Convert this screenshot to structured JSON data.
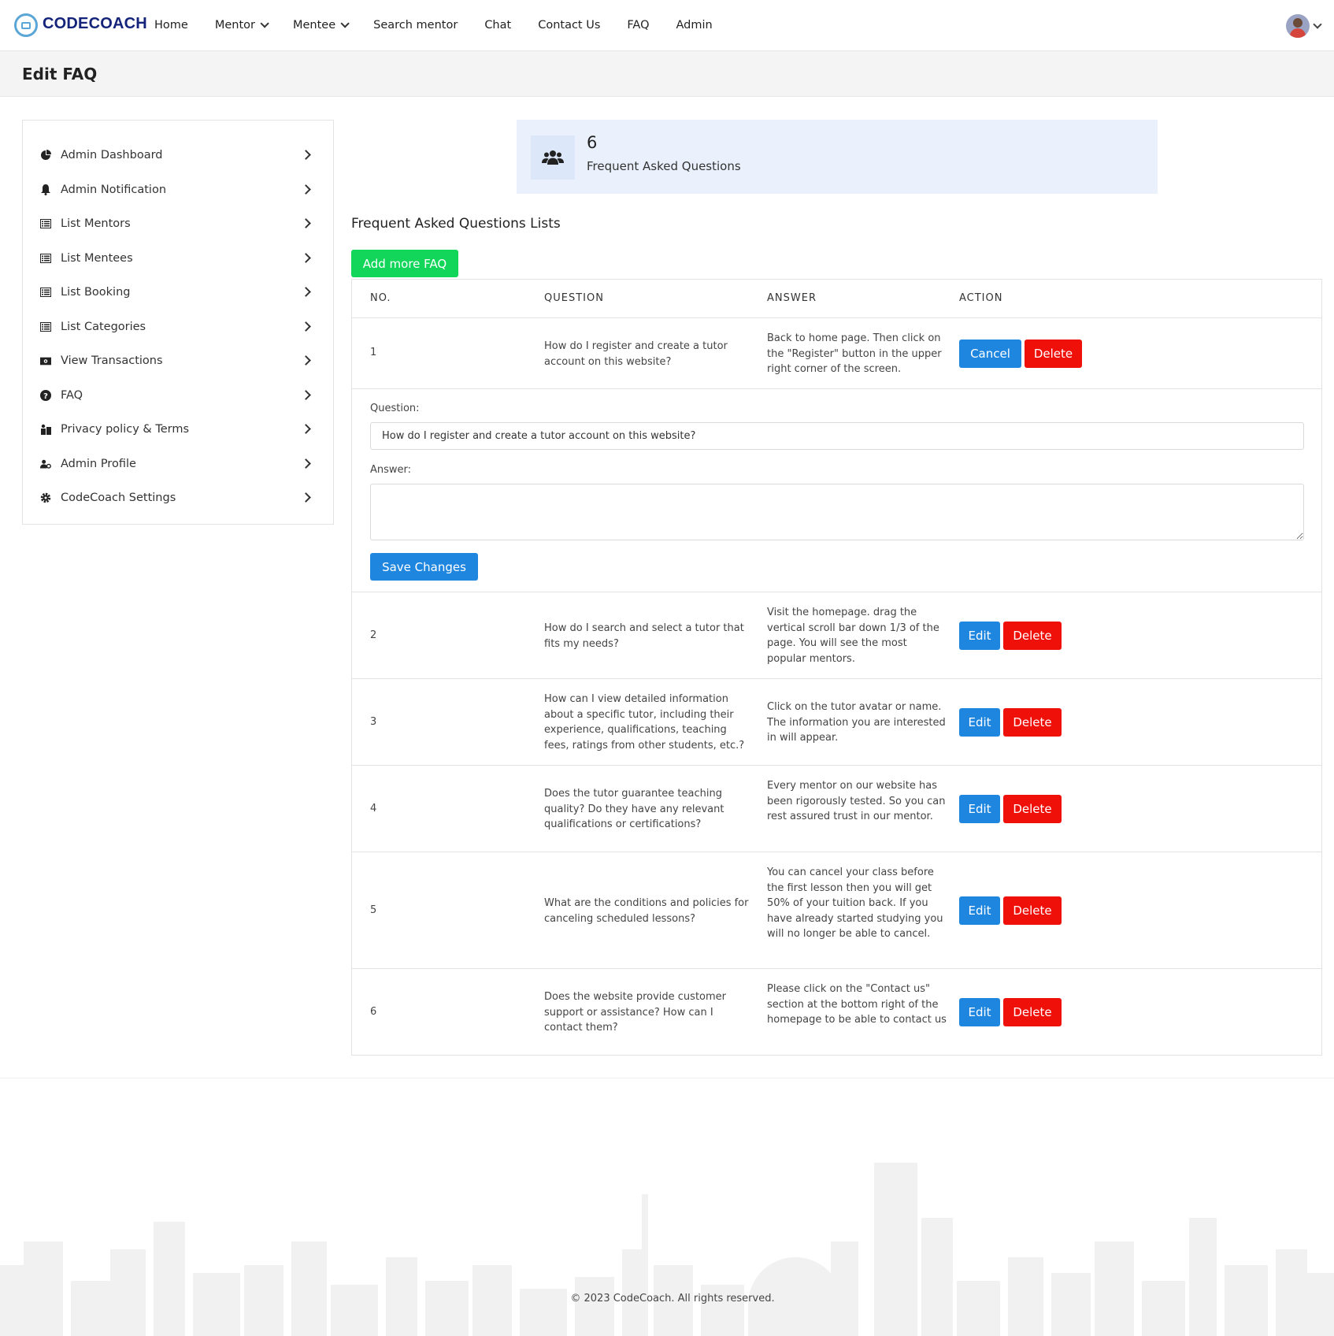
{
  "brand": {
    "name": "CODECOACH"
  },
  "nav": {
    "items": [
      {
        "label": "Home"
      },
      {
        "label": "Mentor"
      },
      {
        "label": "Mentee"
      },
      {
        "label": "Search mentor"
      },
      {
        "label": "Chat"
      },
      {
        "label": "Contact Us"
      },
      {
        "label": "FAQ"
      },
      {
        "label": "Admin"
      }
    ]
  },
  "page": {
    "title": "Edit FAQ"
  },
  "sidebar": {
    "items": [
      {
        "label": "Admin Dashboard",
        "icon": "pie-chart-icon"
      },
      {
        "label": "Admin Notification",
        "icon": "bell-icon"
      },
      {
        "label": "List Mentors",
        "icon": "list-icon"
      },
      {
        "label": "List Mentees",
        "icon": "list-icon"
      },
      {
        "label": "List Booking",
        "icon": "list-icon"
      },
      {
        "label": "List Categories",
        "icon": "list-icon"
      },
      {
        "label": "View Transactions",
        "icon": "money-icon"
      },
      {
        "label": "FAQ",
        "icon": "question-circle-icon"
      },
      {
        "label": "Privacy policy & Terms",
        "icon": "person-board-icon"
      },
      {
        "label": "Admin Profile",
        "icon": "user-gear-icon"
      },
      {
        "label": "CodeCoach Settings",
        "icon": "gear-icon"
      }
    ]
  },
  "stats": {
    "count": "6",
    "label": "Frequent Asked Questions"
  },
  "faq": {
    "section_title": "Frequent Asked Questions Lists",
    "add_label": "Add more FAQ",
    "headers": {
      "no": "NO.",
      "question": "QUESTION",
      "answer": "ANSWER",
      "action": "ACTION"
    },
    "rows": [
      {
        "no": "1",
        "question": "How do I register and create a tutor account on this website?",
        "answer": "Back to home page. Then click on the \"Register\" button in the upper right corner of the screen."
      },
      {
        "no": "2",
        "question": "How do I search and select a tutor that fits my needs?",
        "answer": "Visit the homepage. drag the vertical scroll bar down 1/3 of the page. You will see the most popular mentors."
      },
      {
        "no": "3",
        "question": "How can I view detailed information about a specific tutor, including their experience, qualifications, teaching fees, ratings from other students, etc.?",
        "answer": "Click on the tutor avatar or name. The information you are interested in will appear."
      },
      {
        "no": "4",
        "question": "Does the tutor guarantee teaching quality? Do they have any relevant qualifications or certifications?",
        "answer": "Every mentor on our website has been rigorously tested. So you can rest assured trust in our mentor."
      },
      {
        "no": "5",
        "question": "What are the conditions and policies for canceling scheduled lessons?",
        "answer": "You can cancel your class before the first lesson then you will get 50% of your tuition back. If you have already started studying you will no longer be able to cancel."
      },
      {
        "no": "6",
        "question": "Does the website provide customer support or assistance? How can I contact them?",
        "answer": "Please click on the \"Contact us\" section at the bottom right of the homepage to be able to contact us"
      }
    ],
    "buttons": {
      "cancel": "Cancel",
      "delete": "Delete",
      "edit": "Edit"
    },
    "edit_form": {
      "question_label": "Question:",
      "question_value": "How do I register and create a tutor account on this website?",
      "answer_label": "Answer:",
      "answer_value": "",
      "save_label": "Save Changes"
    }
  },
  "footer": {
    "copyright": "© 2023 CodeCoach. All rights reserved."
  },
  "colors": {
    "brand": "#14247a",
    "primary": "#1f86e0",
    "danger": "#f0100a",
    "success": "#12d65a",
    "stat_bg": "#eaf1fd"
  }
}
